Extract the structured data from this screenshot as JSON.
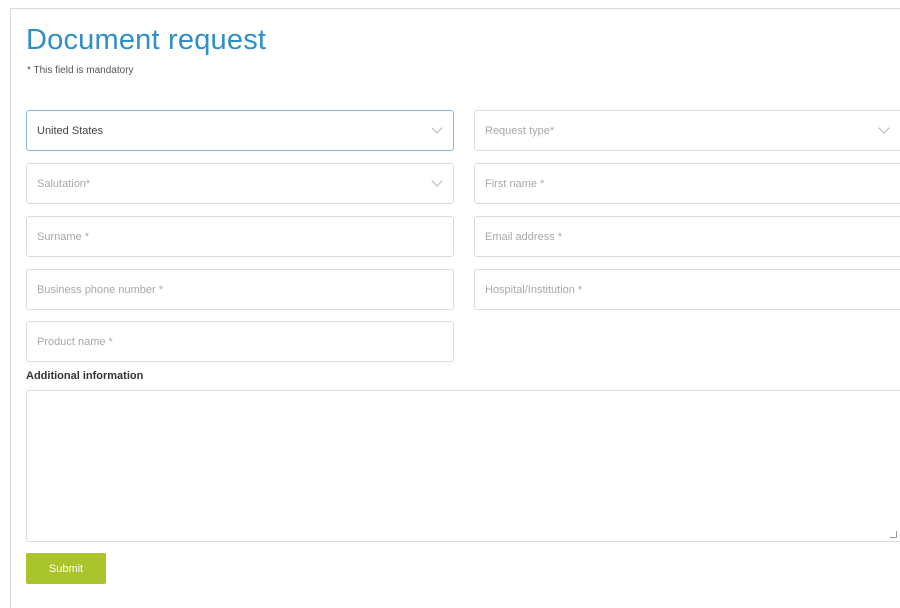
{
  "form": {
    "title": "Document request",
    "mandatory_note": "* This field is mandatory",
    "fields": {
      "country": {
        "value": "United States"
      },
      "request_type": {
        "placeholder": "Request type*"
      },
      "salutation": {
        "placeholder": "Salutation*"
      },
      "first_name": {
        "placeholder": "First name *"
      },
      "surname": {
        "placeholder": "Surname *"
      },
      "email": {
        "placeholder": "Email address *"
      },
      "phone": {
        "placeholder": "Business phone number *"
      },
      "hospital": {
        "placeholder": "Hospital/Institution *"
      },
      "product": {
        "placeholder": "Product name *"
      }
    },
    "additional_info_label": "Additional information",
    "submit_label": "Submit"
  }
}
